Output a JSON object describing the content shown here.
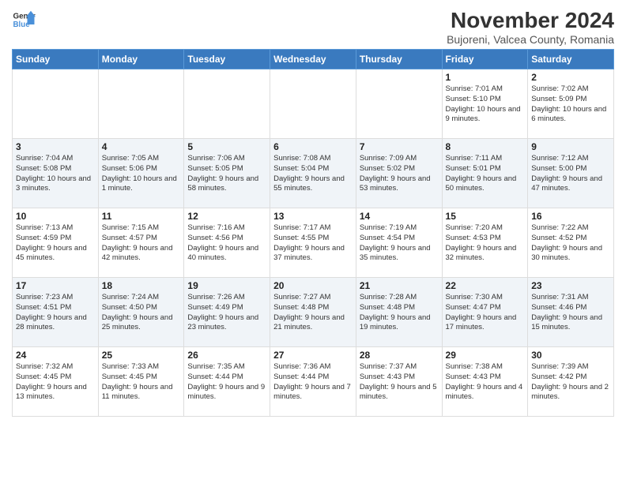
{
  "header": {
    "logo_general": "General",
    "logo_blue": "Blue",
    "title": "November 2024",
    "subtitle": "Bujoreni, Valcea County, Romania"
  },
  "weekdays": [
    "Sunday",
    "Monday",
    "Tuesday",
    "Wednesday",
    "Thursday",
    "Friday",
    "Saturday"
  ],
  "weeks": [
    [
      {
        "day": "",
        "content": ""
      },
      {
        "day": "",
        "content": ""
      },
      {
        "day": "",
        "content": ""
      },
      {
        "day": "",
        "content": ""
      },
      {
        "day": "",
        "content": ""
      },
      {
        "day": "1",
        "content": "Sunrise: 7:01 AM\nSunset: 5:10 PM\nDaylight: 10 hours and 9 minutes."
      },
      {
        "day": "2",
        "content": "Sunrise: 7:02 AM\nSunset: 5:09 PM\nDaylight: 10 hours and 6 minutes."
      }
    ],
    [
      {
        "day": "3",
        "content": "Sunrise: 7:04 AM\nSunset: 5:08 PM\nDaylight: 10 hours and 3 minutes."
      },
      {
        "day": "4",
        "content": "Sunrise: 7:05 AM\nSunset: 5:06 PM\nDaylight: 10 hours and 1 minute."
      },
      {
        "day": "5",
        "content": "Sunrise: 7:06 AM\nSunset: 5:05 PM\nDaylight: 9 hours and 58 minutes."
      },
      {
        "day": "6",
        "content": "Sunrise: 7:08 AM\nSunset: 5:04 PM\nDaylight: 9 hours and 55 minutes."
      },
      {
        "day": "7",
        "content": "Sunrise: 7:09 AM\nSunset: 5:02 PM\nDaylight: 9 hours and 53 minutes."
      },
      {
        "day": "8",
        "content": "Sunrise: 7:11 AM\nSunset: 5:01 PM\nDaylight: 9 hours and 50 minutes."
      },
      {
        "day": "9",
        "content": "Sunrise: 7:12 AM\nSunset: 5:00 PM\nDaylight: 9 hours and 47 minutes."
      }
    ],
    [
      {
        "day": "10",
        "content": "Sunrise: 7:13 AM\nSunset: 4:59 PM\nDaylight: 9 hours and 45 minutes."
      },
      {
        "day": "11",
        "content": "Sunrise: 7:15 AM\nSunset: 4:57 PM\nDaylight: 9 hours and 42 minutes."
      },
      {
        "day": "12",
        "content": "Sunrise: 7:16 AM\nSunset: 4:56 PM\nDaylight: 9 hours and 40 minutes."
      },
      {
        "day": "13",
        "content": "Sunrise: 7:17 AM\nSunset: 4:55 PM\nDaylight: 9 hours and 37 minutes."
      },
      {
        "day": "14",
        "content": "Sunrise: 7:19 AM\nSunset: 4:54 PM\nDaylight: 9 hours and 35 minutes."
      },
      {
        "day": "15",
        "content": "Sunrise: 7:20 AM\nSunset: 4:53 PM\nDaylight: 9 hours and 32 minutes."
      },
      {
        "day": "16",
        "content": "Sunrise: 7:22 AM\nSunset: 4:52 PM\nDaylight: 9 hours and 30 minutes."
      }
    ],
    [
      {
        "day": "17",
        "content": "Sunrise: 7:23 AM\nSunset: 4:51 PM\nDaylight: 9 hours and 28 minutes."
      },
      {
        "day": "18",
        "content": "Sunrise: 7:24 AM\nSunset: 4:50 PM\nDaylight: 9 hours and 25 minutes."
      },
      {
        "day": "19",
        "content": "Sunrise: 7:26 AM\nSunset: 4:49 PM\nDaylight: 9 hours and 23 minutes."
      },
      {
        "day": "20",
        "content": "Sunrise: 7:27 AM\nSunset: 4:48 PM\nDaylight: 9 hours and 21 minutes."
      },
      {
        "day": "21",
        "content": "Sunrise: 7:28 AM\nSunset: 4:48 PM\nDaylight: 9 hours and 19 minutes."
      },
      {
        "day": "22",
        "content": "Sunrise: 7:30 AM\nSunset: 4:47 PM\nDaylight: 9 hours and 17 minutes."
      },
      {
        "day": "23",
        "content": "Sunrise: 7:31 AM\nSunset: 4:46 PM\nDaylight: 9 hours and 15 minutes."
      }
    ],
    [
      {
        "day": "24",
        "content": "Sunrise: 7:32 AM\nSunset: 4:45 PM\nDaylight: 9 hours and 13 minutes."
      },
      {
        "day": "25",
        "content": "Sunrise: 7:33 AM\nSunset: 4:45 PM\nDaylight: 9 hours and 11 minutes."
      },
      {
        "day": "26",
        "content": "Sunrise: 7:35 AM\nSunset: 4:44 PM\nDaylight: 9 hours and 9 minutes."
      },
      {
        "day": "27",
        "content": "Sunrise: 7:36 AM\nSunset: 4:44 PM\nDaylight: 9 hours and 7 minutes."
      },
      {
        "day": "28",
        "content": "Sunrise: 7:37 AM\nSunset: 4:43 PM\nDaylight: 9 hours and 5 minutes."
      },
      {
        "day": "29",
        "content": "Sunrise: 7:38 AM\nSunset: 4:43 PM\nDaylight: 9 hours and 4 minutes."
      },
      {
        "day": "30",
        "content": "Sunrise: 7:39 AM\nSunset: 4:42 PM\nDaylight: 9 hours and 2 minutes."
      }
    ]
  ]
}
